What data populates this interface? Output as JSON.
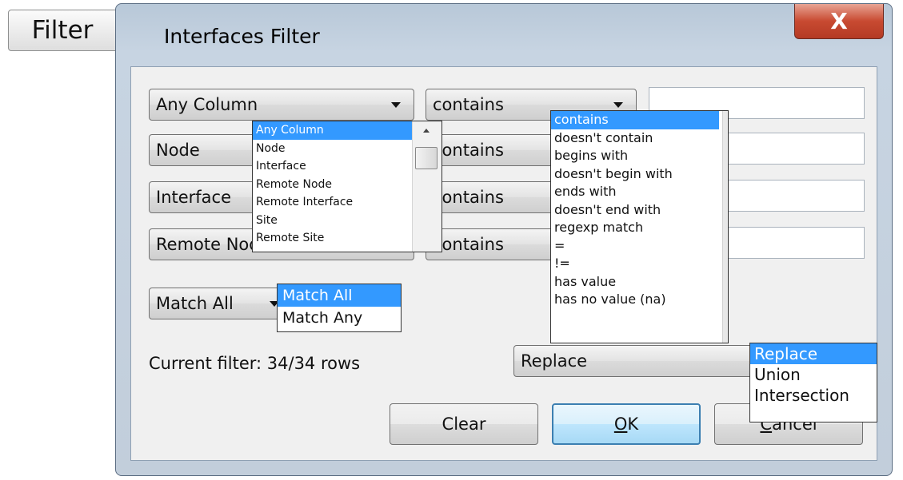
{
  "filter_button": {
    "label": "Filter"
  },
  "window": {
    "title": "Interfaces  Filter",
    "close_glyph": "X"
  },
  "rows": [
    {
      "column": "Any Column",
      "operator": "contains",
      "value": ""
    },
    {
      "column": "Node",
      "operator": "contains",
      "value": ""
    },
    {
      "column": "Interface",
      "operator": "contains",
      "value": ""
    },
    {
      "column": "Remote Node",
      "operator": "contains",
      "value": ""
    }
  ],
  "column_options": [
    "Any Column",
    "Node",
    "Interface",
    "Remote Node",
    "Remote Interface",
    "Site",
    "Remote Site"
  ],
  "operator_options": [
    "contains",
    "doesn't contain",
    "begins with",
    "doesn't begin with",
    "ends with",
    "doesn't end with",
    "regexp match",
    "=",
    "!=",
    "has value",
    "has no value (na)"
  ],
  "match": {
    "selected": "Match All",
    "options": [
      "Match All",
      "Match Any"
    ]
  },
  "status": "Current filter: 34/34 rows",
  "merge": {
    "selected": "Replace",
    "options": [
      "Replace",
      "Union",
      "Intersection"
    ]
  },
  "buttons": {
    "clear": "Clear",
    "ok_mnemonic": "O",
    "ok_rest": "K",
    "cancel_mnemonic": "C",
    "cancel_rest": "ancel"
  },
  "colors": {
    "selection": "#3399ff",
    "close": "#c84a31",
    "client_bg": "#f0f0f0"
  }
}
